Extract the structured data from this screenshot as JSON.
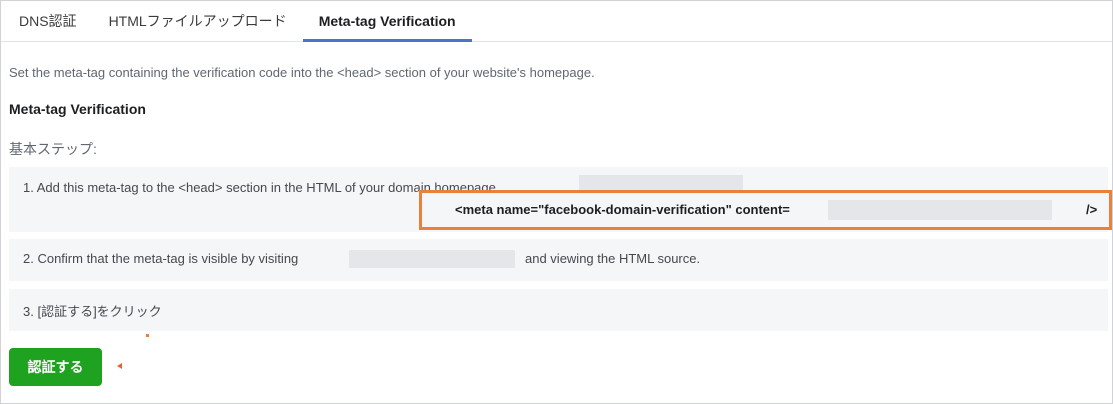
{
  "tabs": [
    {
      "label": "DNS認証",
      "active": false
    },
    {
      "label": "HTMLファイルアップロード",
      "active": false
    },
    {
      "label": "Meta-tag Verification",
      "active": true
    }
  ],
  "description": "Set the meta-tag containing the verification code into the <head> section of your website's homepage.",
  "section_title": "Meta-tag Verification",
  "steps_label": "基本ステップ:",
  "steps": {
    "step1_text": "1. Add this meta-tag to the <head> section in the HTML of your domain homepage",
    "meta_open": "<meta name=\"facebook-domain-verification\" content=",
    "meta_close": "/>",
    "step2_prefix": "2. Confirm that the meta-tag is visible by visiting",
    "step2_suffix": "and viewing the HTML source.",
    "step3_text": "3. [認証する]をクリック"
  },
  "verify_button_label": "認証する",
  "colors": {
    "accent_tab": "#4a76c9",
    "highlight_border": "#e8813a",
    "button_green": "#1fa21f"
  }
}
